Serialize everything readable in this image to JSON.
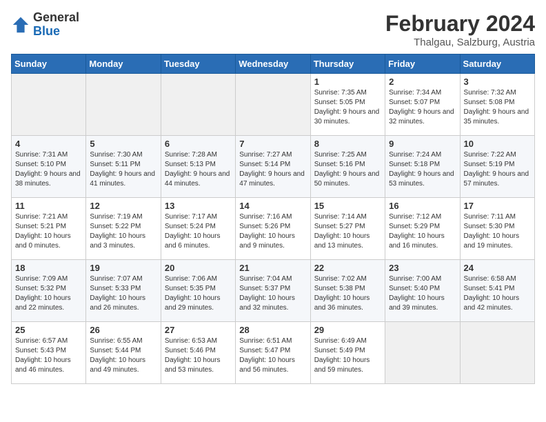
{
  "header": {
    "logo_general": "General",
    "logo_blue": "Blue",
    "month_year": "February 2024",
    "location": "Thalgau, Salzburg, Austria"
  },
  "days_of_week": [
    "Sunday",
    "Monday",
    "Tuesday",
    "Wednesday",
    "Thursday",
    "Friday",
    "Saturday"
  ],
  "weeks": [
    [
      {
        "day": "",
        "info": ""
      },
      {
        "day": "",
        "info": ""
      },
      {
        "day": "",
        "info": ""
      },
      {
        "day": "",
        "info": ""
      },
      {
        "day": "1",
        "info": "Sunrise: 7:35 AM\nSunset: 5:05 PM\nDaylight: 9 hours and 30 minutes."
      },
      {
        "day": "2",
        "info": "Sunrise: 7:34 AM\nSunset: 5:07 PM\nDaylight: 9 hours and 32 minutes."
      },
      {
        "day": "3",
        "info": "Sunrise: 7:32 AM\nSunset: 5:08 PM\nDaylight: 9 hours and 35 minutes."
      }
    ],
    [
      {
        "day": "4",
        "info": "Sunrise: 7:31 AM\nSunset: 5:10 PM\nDaylight: 9 hours and 38 minutes."
      },
      {
        "day": "5",
        "info": "Sunrise: 7:30 AM\nSunset: 5:11 PM\nDaylight: 9 hours and 41 minutes."
      },
      {
        "day": "6",
        "info": "Sunrise: 7:28 AM\nSunset: 5:13 PM\nDaylight: 9 hours and 44 minutes."
      },
      {
        "day": "7",
        "info": "Sunrise: 7:27 AM\nSunset: 5:14 PM\nDaylight: 9 hours and 47 minutes."
      },
      {
        "day": "8",
        "info": "Sunrise: 7:25 AM\nSunset: 5:16 PM\nDaylight: 9 hours and 50 minutes."
      },
      {
        "day": "9",
        "info": "Sunrise: 7:24 AM\nSunset: 5:18 PM\nDaylight: 9 hours and 53 minutes."
      },
      {
        "day": "10",
        "info": "Sunrise: 7:22 AM\nSunset: 5:19 PM\nDaylight: 9 hours and 57 minutes."
      }
    ],
    [
      {
        "day": "11",
        "info": "Sunrise: 7:21 AM\nSunset: 5:21 PM\nDaylight: 10 hours and 0 minutes."
      },
      {
        "day": "12",
        "info": "Sunrise: 7:19 AM\nSunset: 5:22 PM\nDaylight: 10 hours and 3 minutes."
      },
      {
        "day": "13",
        "info": "Sunrise: 7:17 AM\nSunset: 5:24 PM\nDaylight: 10 hours and 6 minutes."
      },
      {
        "day": "14",
        "info": "Sunrise: 7:16 AM\nSunset: 5:26 PM\nDaylight: 10 hours and 9 minutes."
      },
      {
        "day": "15",
        "info": "Sunrise: 7:14 AM\nSunset: 5:27 PM\nDaylight: 10 hours and 13 minutes."
      },
      {
        "day": "16",
        "info": "Sunrise: 7:12 AM\nSunset: 5:29 PM\nDaylight: 10 hours and 16 minutes."
      },
      {
        "day": "17",
        "info": "Sunrise: 7:11 AM\nSunset: 5:30 PM\nDaylight: 10 hours and 19 minutes."
      }
    ],
    [
      {
        "day": "18",
        "info": "Sunrise: 7:09 AM\nSunset: 5:32 PM\nDaylight: 10 hours and 22 minutes."
      },
      {
        "day": "19",
        "info": "Sunrise: 7:07 AM\nSunset: 5:33 PM\nDaylight: 10 hours and 26 minutes."
      },
      {
        "day": "20",
        "info": "Sunrise: 7:06 AM\nSunset: 5:35 PM\nDaylight: 10 hours and 29 minutes."
      },
      {
        "day": "21",
        "info": "Sunrise: 7:04 AM\nSunset: 5:37 PM\nDaylight: 10 hours and 32 minutes."
      },
      {
        "day": "22",
        "info": "Sunrise: 7:02 AM\nSunset: 5:38 PM\nDaylight: 10 hours and 36 minutes."
      },
      {
        "day": "23",
        "info": "Sunrise: 7:00 AM\nSunset: 5:40 PM\nDaylight: 10 hours and 39 minutes."
      },
      {
        "day": "24",
        "info": "Sunrise: 6:58 AM\nSunset: 5:41 PM\nDaylight: 10 hours and 42 minutes."
      }
    ],
    [
      {
        "day": "25",
        "info": "Sunrise: 6:57 AM\nSunset: 5:43 PM\nDaylight: 10 hours and 46 minutes."
      },
      {
        "day": "26",
        "info": "Sunrise: 6:55 AM\nSunset: 5:44 PM\nDaylight: 10 hours and 49 minutes."
      },
      {
        "day": "27",
        "info": "Sunrise: 6:53 AM\nSunset: 5:46 PM\nDaylight: 10 hours and 53 minutes."
      },
      {
        "day": "28",
        "info": "Sunrise: 6:51 AM\nSunset: 5:47 PM\nDaylight: 10 hours and 56 minutes."
      },
      {
        "day": "29",
        "info": "Sunrise: 6:49 AM\nSunset: 5:49 PM\nDaylight: 10 hours and 59 minutes."
      },
      {
        "day": "",
        "info": ""
      },
      {
        "day": "",
        "info": ""
      }
    ]
  ]
}
